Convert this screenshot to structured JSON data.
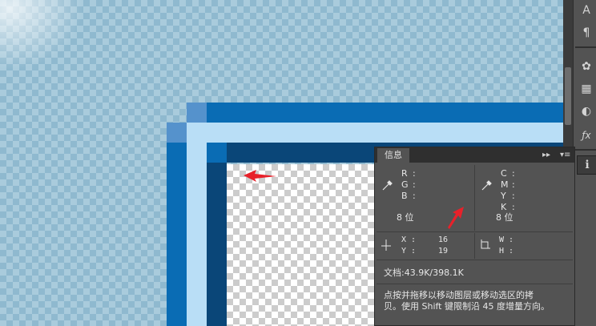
{
  "window": {
    "title": "信息"
  },
  "info_panel": {
    "tab_label": "信息",
    "rgb": {
      "r_label": "R",
      "g_label": "G",
      "b_label": "B",
      "bits": "8 位"
    },
    "cmyk": {
      "c_label": "C",
      "m_label": "M",
      "y_label": "Y",
      "k_label": "K",
      "bits": "8 位"
    },
    "position": {
      "x_label": "X",
      "x_value": "16",
      "y_label": "Y",
      "y_value": "19"
    },
    "size": {
      "w_label": "W",
      "h_label": "H"
    },
    "doc": "文档:43.9K/398.1K",
    "hint_line1": "点按并拖移以移动图层或移动选区的拷",
    "hint_line2": "贝。使用 Shift 键限制沿 45 度增量方向。",
    "colon": ":"
  },
  "toolstrip": {
    "tools": [
      {
        "name": "character-icon",
        "glyph": "A"
      },
      {
        "name": "paragraph-icon",
        "glyph": "¶"
      },
      {
        "name": "brush-presets-icon",
        "glyph": "✿"
      },
      {
        "name": "swatches-icon",
        "glyph": "▦"
      },
      {
        "name": "styles-icon",
        "glyph": "◐"
      },
      {
        "name": "actions-icon",
        "glyph": "ƒx"
      },
      {
        "name": "info-icon",
        "glyph": "ℹ"
      }
    ]
  },
  "colors": {
    "canvas_bg": "#a9cbdc",
    "frame_blue": "#0a6cb4",
    "frame_light": "#b9def6",
    "frame_dark": "#0a4678",
    "annotation_red": "#e8212a",
    "panel_bg": "#535353"
  }
}
